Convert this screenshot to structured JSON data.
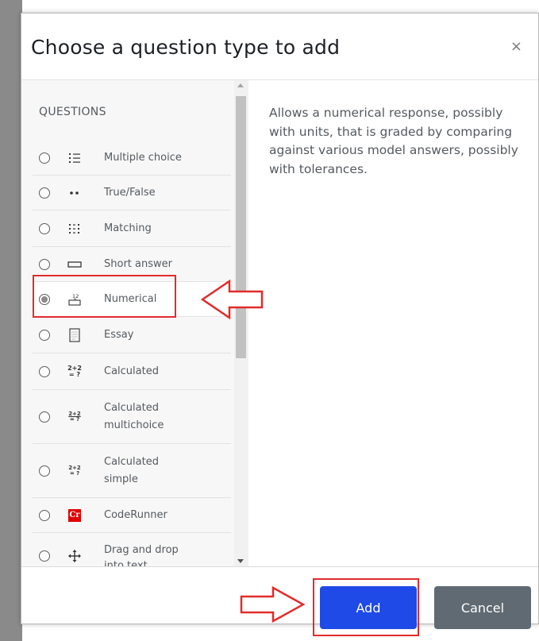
{
  "dialog": {
    "title": "Choose a question type to add",
    "close_glyph": "×"
  },
  "options_panel": {
    "section_label": "QUESTIONS",
    "items": [
      {
        "label": "Multiple choice",
        "icon": "multiple-choice-icon",
        "selected": false
      },
      {
        "label": "True/False",
        "icon": "true-false-icon",
        "selected": false
      },
      {
        "label": "Matching",
        "icon": "matching-icon",
        "selected": false
      },
      {
        "label": "Short answer",
        "icon": "short-answer-icon",
        "selected": false
      },
      {
        "label": "Numerical",
        "icon": "numerical-icon",
        "selected": true
      },
      {
        "label": "Essay",
        "icon": "essay-icon",
        "selected": false
      },
      {
        "label": "Calculated",
        "icon": "calculated-icon",
        "selected": false
      },
      {
        "label": "Calculated multichoice",
        "icon": "calculated-multichoice-icon",
        "selected": false
      },
      {
        "label": "Calculated simple",
        "icon": "calculated-simple-icon",
        "selected": false
      },
      {
        "label": "CodeRunner",
        "icon": "coderunner-icon",
        "selected": false
      },
      {
        "label": "Drag and drop into text",
        "icon": "drag-drop-icon",
        "selected": false
      }
    ]
  },
  "icons": {
    "numerical_top": "12",
    "calc_top": "2+2",
    "calc_bottom": "= ?",
    "coderunner": "Cr"
  },
  "description": "Allows a numerical response, possibly with units, that is graded by comparing against various model answers, possibly with tolerances.",
  "footer": {
    "add_label": "Add",
    "cancel_label": "Cancel"
  },
  "colors": {
    "accent": "#1f4ae8",
    "cancel": "#5f6a73",
    "annotation": "#e32b2b",
    "coderunner_red": "#e00000"
  }
}
